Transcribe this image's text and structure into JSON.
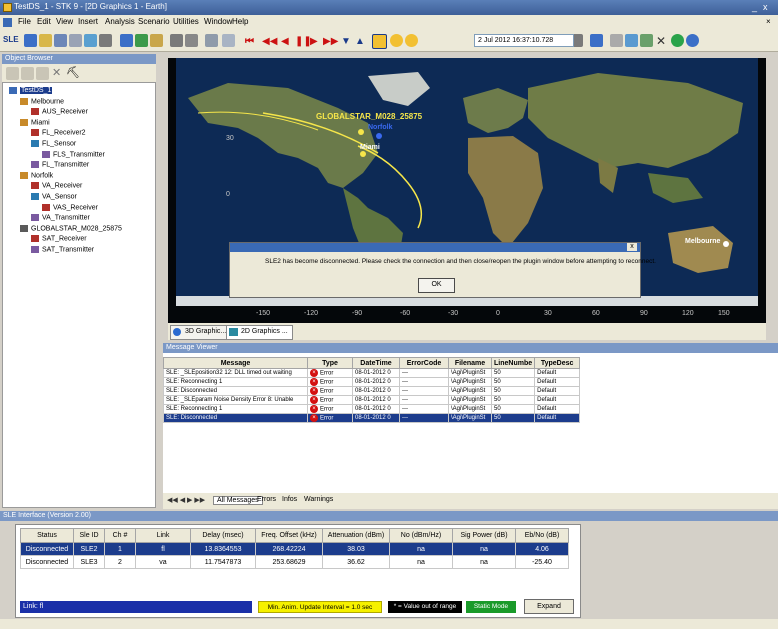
{
  "window": {
    "title": "TestDS_1 - STK 9 - [2D Graphics 1 - Earth]",
    "minimize": "_",
    "restore": "▫",
    "close": "x"
  },
  "menu": [
    "File",
    "Edit",
    "View",
    "Insert",
    "Analysis",
    "Scenario",
    "Utilities",
    "Window",
    "Help"
  ],
  "toolbar": {
    "scenario_label": "SLE",
    "time_display": "2 Jul 2012 16:37:10.728"
  },
  "object_browser": {
    "title": "Object Browser",
    "tree": [
      {
        "label": "TestDS_1",
        "level": 0,
        "icon": "scenario-icon",
        "selected": true
      },
      {
        "label": "Melbourne",
        "level": 1,
        "icon": "facility-icon"
      },
      {
        "label": "AUS_Receiver",
        "level": 2,
        "icon": "receiver-icon"
      },
      {
        "label": "Miami",
        "level": 1,
        "icon": "facility-icon"
      },
      {
        "label": "FL_Receiver2",
        "level": 2,
        "icon": "receiver-icon"
      },
      {
        "label": "FL_Sensor",
        "level": 2,
        "icon": "sensor-icon"
      },
      {
        "label": "FLS_Transmitter",
        "level": 3,
        "icon": "transmitter-icon"
      },
      {
        "label": "FL_Transmitter",
        "level": 2,
        "icon": "transmitter-icon"
      },
      {
        "label": "Norfolk",
        "level": 1,
        "icon": "facility-icon"
      },
      {
        "label": "VA_Receiver",
        "level": 2,
        "icon": "receiver-icon"
      },
      {
        "label": "VA_Sensor",
        "level": 2,
        "icon": "sensor-icon"
      },
      {
        "label": "VAS_Receiver",
        "level": 3,
        "icon": "receiver-icon"
      },
      {
        "label": "VA_Transmitter",
        "level": 2,
        "icon": "transmitter-icon"
      },
      {
        "label": "GLOBALSTAR_M028_25875",
        "level": 1,
        "icon": "satellite-icon"
      },
      {
        "label": "SAT_Receiver",
        "level": 2,
        "icon": "receiver-icon"
      },
      {
        "label": "SAT_Transmitter",
        "level": 2,
        "icon": "transmitter-icon"
      }
    ]
  },
  "map": {
    "satellite_label": "GLOBALSTAR_M028_25875",
    "norfolk_label": "Norfolk",
    "miami_label": "Miami",
    "melbourne_label": "Melbourne",
    "lon_labels": [
      "-150",
      "-120",
      "-90",
      "-60",
      "-30",
      "0",
      "30",
      "60",
      "90",
      "120",
      "150"
    ],
    "lat_labels": [
      "30",
      "0"
    ],
    "tabs": [
      "3D Graphic...",
      "2D Graphics ..."
    ]
  },
  "dialog": {
    "message": "SLE2 has become disconnected.  Please check the connection and then close/reopen the plugin window before attempting to reconnect.",
    "close": "x",
    "ok": "OK"
  },
  "message_viewer": {
    "title": "Message Viewer",
    "columns": [
      "Message",
      "Type",
      "DateTime",
      "ErrorCode",
      "Filename",
      "LineNumbe",
      "TypeDesc"
    ],
    "rows": [
      [
        "SLE: _SLEposition32 12: DLL timed out waiting",
        "Error",
        "08-01-2012 0",
        "---",
        "\\Agi\\PluginSt",
        "50",
        "Default"
      ],
      [
        "SLE: Reconnecting 1",
        "Error",
        "08-01-2012 0",
        "---",
        "\\Agi\\PluginSt",
        "50",
        "Default"
      ],
      [
        "SLE: Disconnected",
        "Error",
        "08-01-2012 0",
        "---",
        "\\Agi\\PluginSt",
        "50",
        "Default"
      ],
      [
        "SLE: _SLEparam Noise Density Error 8: Unable",
        "Error",
        "08-01-2012 0",
        "---",
        "\\Agi\\PluginSt",
        "50",
        "Default"
      ],
      [
        "SLE: Reconnecting 1",
        "Error",
        "08-01-2012 0",
        "---",
        "\\Agi\\PluginSt",
        "50",
        "Default"
      ],
      [
        "SLE: Disconnected",
        "Error",
        "08-01-2012 0",
        "---",
        "\\Agi\\PluginSt",
        "50",
        "Default"
      ]
    ],
    "tabs": [
      "All Messages",
      "Errors",
      "Infos",
      "Warnings"
    ]
  },
  "sle_panel": {
    "title": "SLE Interface (Version 2.00)",
    "columns": [
      "Status",
      "Sle ID",
      "Ch #",
      "Link",
      "Delay (msec)",
      "Freq. Offset (kHz)",
      "Attenuation (dBm)",
      "No (dBm/Hz)",
      "Sig Power (dB)",
      "Eb/No (dB)"
    ],
    "rows": [
      [
        "Disconnected",
        "SLE2",
        "1",
        "fl",
        "13.8364553",
        "268.42224",
        "38.03",
        "na",
        "na",
        "4.06"
      ],
      [
        "Disconnected",
        "SLE3",
        "2",
        "va",
        "11.7547873",
        "253.68629",
        "36.62",
        "na",
        "na",
        "-25.40"
      ]
    ],
    "link_label": "Link: fl",
    "min_anim": "Min. Anim. Update Interval = 1.0 sec",
    "value_out_of_range": "* = Value out of range",
    "static_mode": "Static Mode",
    "expand": "Expand"
  },
  "colors": {
    "selection": "#1c3c8c",
    "error": "#d31010",
    "static_mode": "#1a9a2a",
    "min_anim": "#f6f100",
    "link_bar": "#1a2fa8"
  }
}
